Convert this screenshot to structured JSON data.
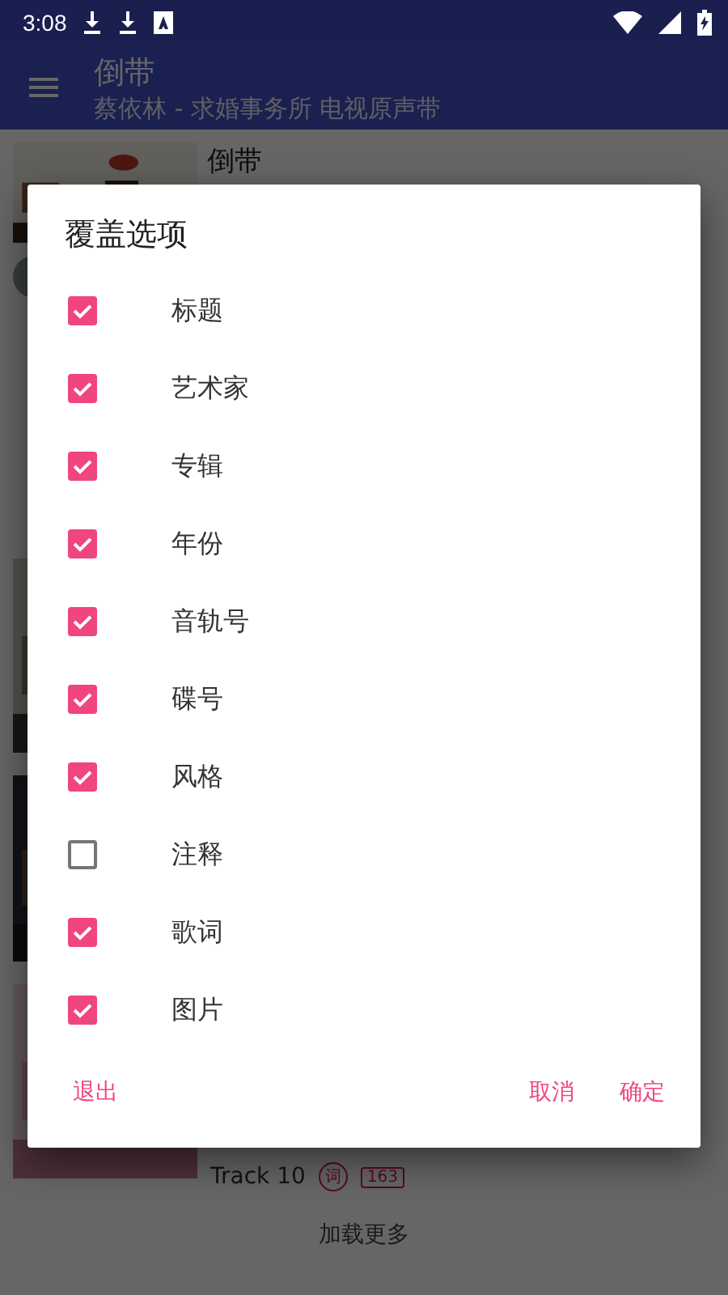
{
  "status_bar": {
    "time": "3:08"
  },
  "app_bar": {
    "title": "倒带",
    "subtitle": "蔡依林 - 求婚事务所 电视原声带"
  },
  "list": {
    "items": [
      {
        "title": "倒带"
      },
      {
        "title": "Track 10",
        "badges": [
          {
            "kind": "circle",
            "text": "词"
          },
          {
            "kind": "box",
            "text": "163"
          }
        ]
      }
    ],
    "load_more": "加载更多"
  },
  "dialog": {
    "title": "覆盖选项",
    "options": [
      {
        "label": "标题",
        "checked": true
      },
      {
        "label": "艺术家",
        "checked": true
      },
      {
        "label": "专辑",
        "checked": true
      },
      {
        "label": "年份",
        "checked": true
      },
      {
        "label": "音轨号",
        "checked": true
      },
      {
        "label": "碟号",
        "checked": true
      },
      {
        "label": "风格",
        "checked": true
      },
      {
        "label": "注释",
        "checked": false
      },
      {
        "label": "歌词",
        "checked": true
      },
      {
        "label": "图片",
        "checked": true
      }
    ],
    "buttons": [
      {
        "label": "退出",
        "kind": "left"
      },
      {
        "label": "取消",
        "kind": "right"
      },
      {
        "label": "确定",
        "kind": "right"
      }
    ]
  }
}
